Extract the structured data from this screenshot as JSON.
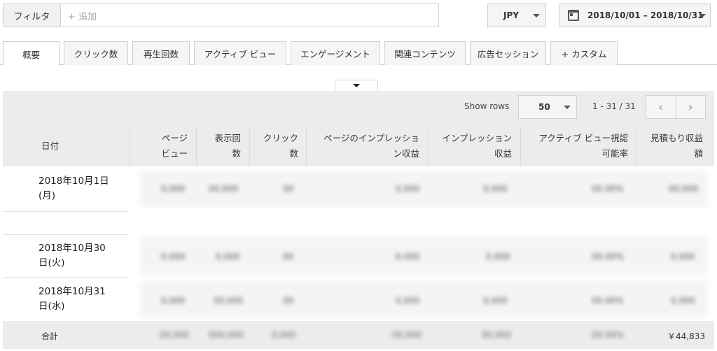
{
  "filter": {
    "label": "フィルタ",
    "placeholder": "+ 追加"
  },
  "currency": {
    "value": "JPY"
  },
  "date_range": {
    "value": "2018/10/01 – 2018/10/31"
  },
  "tabs": [
    {
      "label": "概要",
      "active": true
    },
    {
      "label": "クリック数"
    },
    {
      "label": "再生回数"
    },
    {
      "label": "アクティブ ビュー"
    },
    {
      "label": "エンゲージメント"
    },
    {
      "label": "関連コンテンツ"
    },
    {
      "label": "広告セッション"
    },
    {
      "label": "+ カスタム"
    }
  ],
  "table": {
    "show_rows_label": "Show rows",
    "rows_value": "50",
    "range_text": "1 - 31 / 31",
    "headers": {
      "date": "日付",
      "page_views": "ページ\nビュー",
      "impressions": "表示回\n数",
      "clicks": "クリック\n数",
      "page_impression_revenue": "ページのインプレッショ\nン収益",
      "impression_revenue": "インプレッション\n収益",
      "active_view_rate": "アクティブ ビュー視認\n可能率",
      "estimated_revenue": "見積もり収益\n額"
    },
    "rows": [
      {
        "date": "2018年10月1日\n(月)"
      },
      {
        "date": "2018年10月30\n日(火)"
      },
      {
        "date": "2018年10月31\n日(水)"
      }
    ],
    "total": {
      "label": "合計",
      "estimated_revenue": "￥44,833"
    }
  },
  "colors": {
    "panel_bg": "#ececec",
    "border": "#d0d0d0"
  }
}
